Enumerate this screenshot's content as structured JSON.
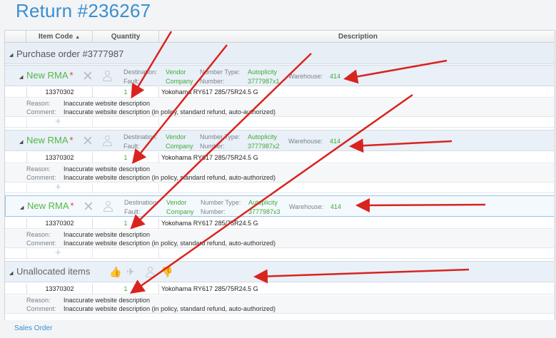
{
  "page_title": "Return #236267",
  "columns": {
    "item_code": "Item Code",
    "quantity": "Quantity",
    "description": "Description"
  },
  "purchase_order": {
    "label": "Purchase order #3777987"
  },
  "rma_groups": [
    {
      "title": "New RMA",
      "required_mark": "*",
      "destination_label": "Destination:",
      "destination_value": "Vendor",
      "fault_label": "Fault:",
      "fault_value": "Company",
      "number_type_label": "Number Type:",
      "number_type_value": "Autoplicity",
      "number_label": "Number:",
      "number_value": "3777987x1",
      "warehouse_label": "Warehouse:",
      "warehouse_value": "414",
      "item": {
        "code": "13370302",
        "qty": "1",
        "description": "Yokohama RY617 285/75R24.5 G"
      },
      "reason_label": "Reason:",
      "reason_value": "Inaccurate website description",
      "comment_label": "Comment:",
      "comment_value": "Inaccurate website description (in policy, standard refund, auto-authorized)",
      "add_symbol": "+"
    },
    {
      "title": "New RMA",
      "required_mark": "*",
      "destination_label": "Destination:",
      "destination_value": "Vendor",
      "fault_label": "Fault:",
      "fault_value": "Company",
      "number_type_label": "Number Type:",
      "number_type_value": "Autoplicity",
      "number_label": "Number:",
      "number_value": "3777987x2",
      "warehouse_label": "Warehouse:",
      "warehouse_value": "414",
      "item": {
        "code": "13370302",
        "qty": "1",
        "description": "Yokohama RY617 285/75R24.5 G"
      },
      "reason_label": "Reason:",
      "reason_value": "Inaccurate website description",
      "comment_label": "Comment:",
      "comment_value": "Inaccurate website description (in policy, standard refund, auto-authorized)",
      "add_symbol": "+"
    },
    {
      "title": "New RMA",
      "required_mark": "*",
      "destination_label": "Destination:",
      "destination_value": "Vendor",
      "fault_label": "Fault:",
      "fault_value": "Company",
      "number_type_label": "Number Type:",
      "number_type_value": "Autoplicity",
      "number_label": "Number:",
      "number_value": "3777987x3",
      "warehouse_label": "Warehouse:",
      "warehouse_value": "414",
      "item": {
        "code": "13370302",
        "qty": "1",
        "description": "Yokohama RY617 285/75R24.5 G"
      },
      "reason_label": "Reason:",
      "reason_value": "Inaccurate website description",
      "comment_label": "Comment:",
      "comment_value": "Inaccurate website description (in policy, standard refund, auto-authorized)",
      "add_symbol": "+"
    }
  ],
  "unallocated": {
    "label": "Unallocated items",
    "item": {
      "code": "13370302",
      "qty": "1",
      "description": "Yokohama RY617 285/75R24.5 G"
    },
    "reason_label": "Reason:",
    "reason_value": "Inaccurate website description",
    "comment_label": "Comment:",
    "comment_value": "Inaccurate website description (in policy, standard refund, auto-authorized)"
  },
  "footer": {
    "sales_order_link": "Sales Order"
  },
  "icons": {
    "delete": "close-icon",
    "assign": "user-icon",
    "unallocated_actions": [
      "thumbs-up-icon",
      "airplane-icon",
      "user-icon",
      "thumbs-down-icon"
    ]
  },
  "colors": {
    "accent": "#3a8fd0",
    "green": "#3faa3a",
    "required": "#e0413b",
    "annotation_arrow": "#d9231f"
  }
}
